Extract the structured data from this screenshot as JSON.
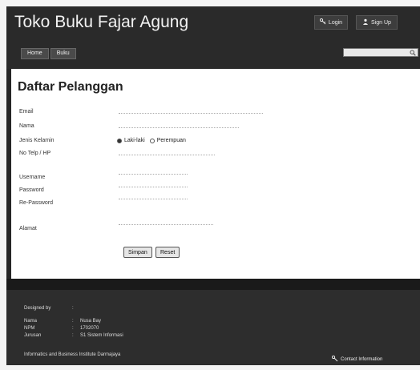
{
  "header": {
    "title": "Toko Buku Fajar Agung",
    "login_label": "Login",
    "signup_label": "Sign Up",
    "nav": [
      {
        "label": "Home"
      },
      {
        "label": "Buku"
      }
    ],
    "search_placeholder": ""
  },
  "form": {
    "title": "Daftar Pelanggan",
    "labels": {
      "email": "Email",
      "nama": "Nama",
      "jenis_kelamin": "Jenis Kelamin",
      "no_telp": "No Telp / HP",
      "username": "Username",
      "password": "Password",
      "re_password": "Re-Password",
      "alamat": "Alamat"
    },
    "values": {
      "email": "",
      "nama": "",
      "no_telp": "",
      "username": "",
      "password": "",
      "re_password": "",
      "alamat": ""
    },
    "gender_options": [
      {
        "label": "Laki-laki",
        "selected": true
      },
      {
        "label": "Perempuan",
        "selected": false
      }
    ],
    "submit_label": "Simpan",
    "reset_label": "Reset"
  },
  "footer": {
    "designed_by_label": "Designed by",
    "designed_by_sep": ":",
    "rows": [
      {
        "key": "Nama",
        "sep": ":",
        "value": "Nusa Bay"
      },
      {
        "key": "NPM",
        "sep": ":",
        "value": "1702070"
      },
      {
        "key": "Jurusan",
        "sep": ":",
        "value": "S1 Sistem Informasi"
      }
    ],
    "institute": "Informatics and Business Institute Darmajaya",
    "contact_label": "Contact Information"
  },
  "icons": {
    "login": "key-icon",
    "signup": "user-icon",
    "search": "search-icon",
    "contact": "pin-icon"
  }
}
